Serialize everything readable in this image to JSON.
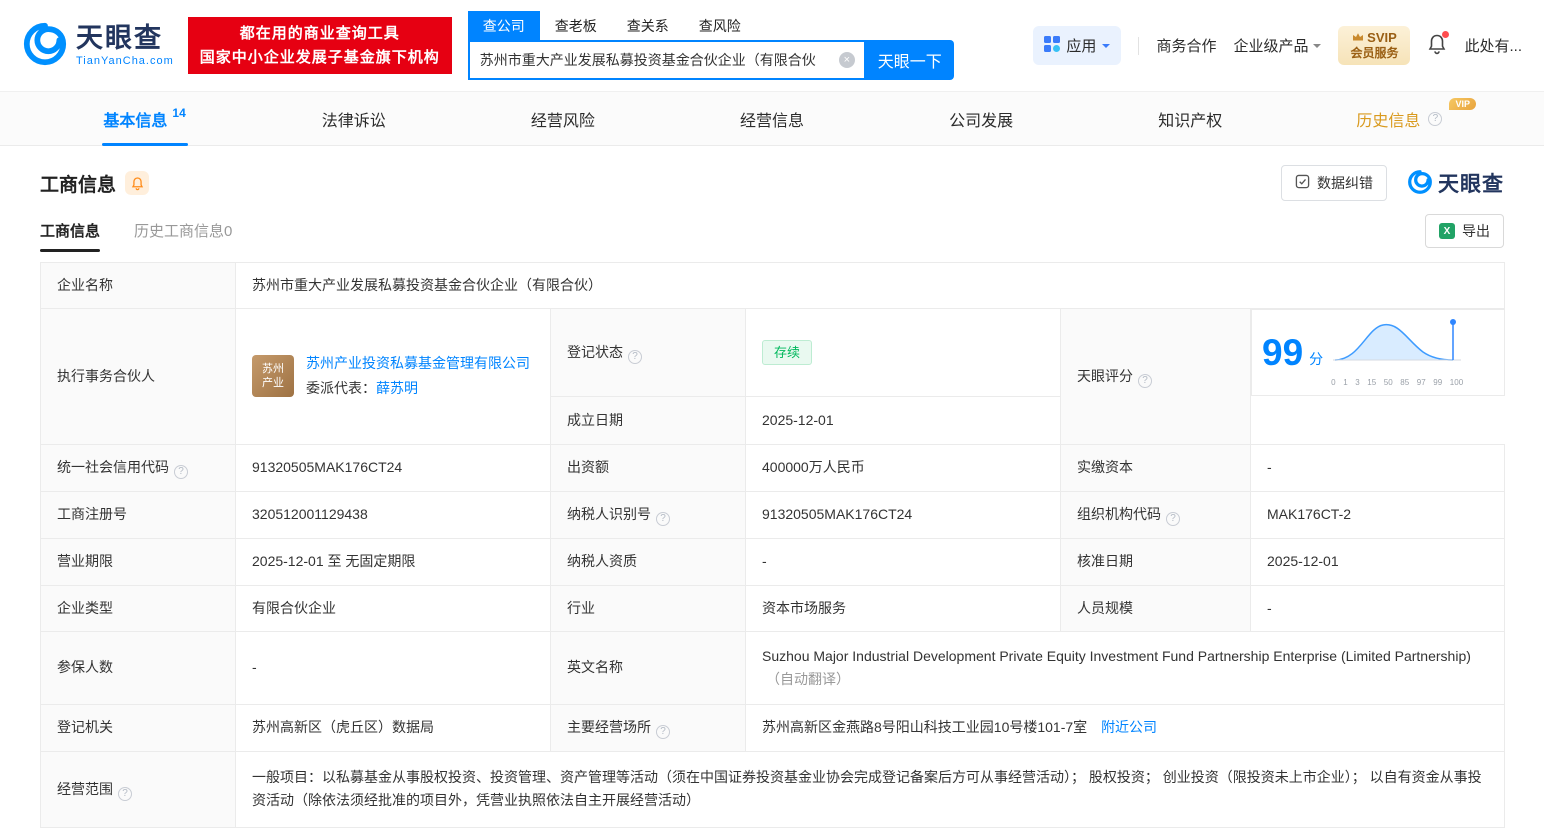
{
  "theme": {
    "brand_blue": "#0084ff",
    "banner_red": "#e60012",
    "status_green": "#00b85c",
    "vip_gold": "#d99a1f"
  },
  "header": {
    "logo": {
      "brand": "天眼查",
      "domain": "TianYanCha.com"
    },
    "banner": {
      "line1": "都在用的商业查询工具",
      "line2": "国家中小企业发展子基金旗下机构"
    },
    "search_tabs": [
      {
        "label": "查公司"
      },
      {
        "label": "查老板"
      },
      {
        "label": "查关系"
      },
      {
        "label": "查风险"
      }
    ],
    "search": {
      "value": "苏州市重大产业发展私募投资基金合伙企业（有限合伙",
      "button_label": "天眼一下"
    },
    "menu": {
      "apps_label": "应用",
      "cooperation_label": "商务合作",
      "enterprise_label": "企业级产品",
      "vip_line1": "SVIP",
      "vip_line2": "会员服务",
      "more_label": "此处有..."
    }
  },
  "nav_tabs": [
    {
      "label": "基本信息",
      "count": "14"
    },
    {
      "label": "法律诉讼"
    },
    {
      "label": "经营风险"
    },
    {
      "label": "经营信息"
    },
    {
      "label": "公司发展"
    },
    {
      "label": "知识产权"
    },
    {
      "label": "历史信息",
      "badge": "VIP"
    }
  ],
  "section": {
    "title": "工商信息",
    "correction_label": "数据纠错",
    "logo_label": "天眼查",
    "sub_tabs": [
      {
        "label": "工商信息"
      },
      {
        "label": "历史工商信息0"
      }
    ],
    "export_label": "导出"
  },
  "info": {
    "company_name": {
      "label": "企业名称",
      "value": "苏州市重大产业发展私募投资基金合伙企业（有限合伙）"
    },
    "partner": {
      "label": "执行事务合伙人",
      "avatar_line1": "苏州",
      "avatar_line2": "产业",
      "company": "苏州产业投资私募基金管理有限公司",
      "delegate_label": "委派代表：",
      "delegate_name": "薛苏明"
    },
    "reg_status": {
      "label": "登记状态",
      "value": "存续"
    },
    "establish_date": {
      "label": "成立日期",
      "value": "2025-12-01"
    },
    "score": {
      "label": "天眼评分",
      "value": "99",
      "unit": "分",
      "axis": [
        "0",
        "1",
        "3",
        "15",
        "50",
        "85",
        "97",
        "99",
        "100"
      ]
    },
    "credit_code": {
      "label": "统一社会信用代码",
      "value": "91320505MAK176CT24"
    },
    "capital": {
      "label": "出资额",
      "value": "400000万人民币"
    },
    "paid_capital": {
      "label": "实缴资本",
      "value": "-"
    },
    "reg_number": {
      "label": "工商注册号",
      "value": "320512001129438"
    },
    "taxpayer_id": {
      "label": "纳税人识别号",
      "value": "91320505MAK176CT24"
    },
    "org_code": {
      "label": "组织机构代码",
      "value": "MAK176CT-2"
    },
    "business_term": {
      "label": "营业期限",
      "value": "2025-12-01 至 无固定期限"
    },
    "taxpayer_quality": {
      "label": "纳税人资质",
      "value": "-"
    },
    "approval_date": {
      "label": "核准日期",
      "value": "2025-12-01"
    },
    "company_type": {
      "label": "企业类型",
      "value": "有限合伙企业"
    },
    "industry": {
      "label": "行业",
      "value": "资本市场服务"
    },
    "staff_size": {
      "label": "人员规模",
      "value": "-"
    },
    "insured_count": {
      "label": "参保人数",
      "value": "-"
    },
    "english_name": {
      "label": "英文名称",
      "value": "Suzhou Major Industrial Development Private Equity Investment Fund Partnership Enterprise (Limited Partnership)",
      "note": "（自动翻译）"
    },
    "registry": {
      "label": "登记机关",
      "value": "苏州高新区（虎丘区）数据局"
    },
    "premises": {
      "label": "主要经营场所",
      "value": "苏州高新区金燕路8号阳山科技工业园10号楼101-7室",
      "link": "附近公司"
    },
    "business_scope": {
      "label": "经营范围",
      "value": "一般项目：以私募基金从事股权投资、投资管理、资产管理等活动（须在中国证券投资基金业协会完成登记备案后方可从事经营活动）； 股权投资； 创业投资（限投资未上市企业）； 以自有资金从事投资活动（除依法须经批准的项目外，凭营业执照依法自主开展经营活动）"
    }
  }
}
